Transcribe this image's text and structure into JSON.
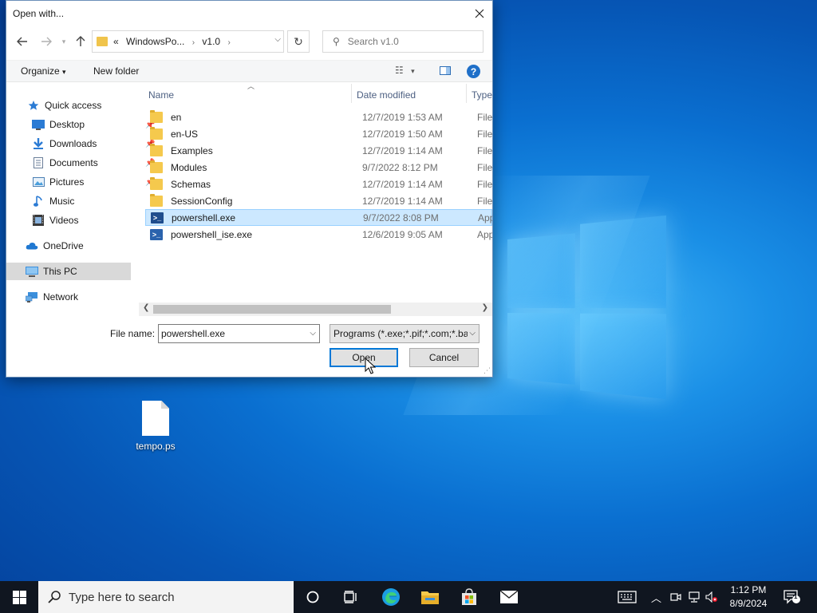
{
  "dialog": {
    "title": "Open with...",
    "address": {
      "prefix": "«",
      "crumbs": [
        "WindowsPo...",
        "v1.0"
      ]
    },
    "search_placeholder": "Search v1.0",
    "toolbar": {
      "organize": "Organize",
      "new_folder": "New folder"
    },
    "nav": [
      {
        "label": "Quick access",
        "icon": "star-icon"
      },
      {
        "label": "Desktop",
        "icon": "desktop-icon",
        "pinned": true
      },
      {
        "label": "Downloads",
        "icon": "downloads-icon",
        "pinned": true
      },
      {
        "label": "Documents",
        "icon": "documents-icon",
        "pinned": true
      },
      {
        "label": "Pictures",
        "icon": "pictures-icon",
        "pinned": true
      },
      {
        "label": "Music",
        "icon": "music-icon"
      },
      {
        "label": "Videos",
        "icon": "videos-icon"
      },
      {
        "label": "OneDrive",
        "icon": "onedrive-icon"
      },
      {
        "label": "This PC",
        "icon": "pc-icon",
        "selected": true
      },
      {
        "label": "Network",
        "icon": "network-icon"
      }
    ],
    "columns": {
      "name": "Name",
      "date": "Date modified",
      "type": "Type"
    },
    "files": [
      {
        "name": "en",
        "date": "12/7/2019 1:53 AM",
        "type": "File fo",
        "kind": "folder"
      },
      {
        "name": "en-US",
        "date": "12/7/2019 1:50 AM",
        "type": "File fo",
        "kind": "folder"
      },
      {
        "name": "Examples",
        "date": "12/7/2019 1:14 AM",
        "type": "File fo",
        "kind": "folder"
      },
      {
        "name": "Modules",
        "date": "9/7/2022 8:12 PM",
        "type": "File fo",
        "kind": "folder"
      },
      {
        "name": "Schemas",
        "date": "12/7/2019 1:14 AM",
        "type": "File fo",
        "kind": "folder"
      },
      {
        "name": "SessionConfig",
        "date": "12/7/2019 1:14 AM",
        "type": "File fo",
        "kind": "folder"
      },
      {
        "name": "powershell.exe",
        "date": "9/7/2022 8:08 PM",
        "type": "Appli",
        "kind": "exe",
        "selected": true
      },
      {
        "name": "powershell_ise.exe",
        "date": "12/6/2019 9:05 AM",
        "type": "Appli",
        "kind": "exe"
      }
    ],
    "file_name_label": "File name:",
    "file_name_value": "powershell.exe",
    "file_type_value": "Programs (*.exe;*.pif;*.com;*.ba",
    "open_label": "Open",
    "cancel_label": "Cancel"
  },
  "desktop": {
    "icon_label": "tempo.ps"
  },
  "taskbar": {
    "search_placeholder": "Type here to search",
    "time": "1:12 PM",
    "date": "8/9/2024",
    "notification_count": "1"
  }
}
